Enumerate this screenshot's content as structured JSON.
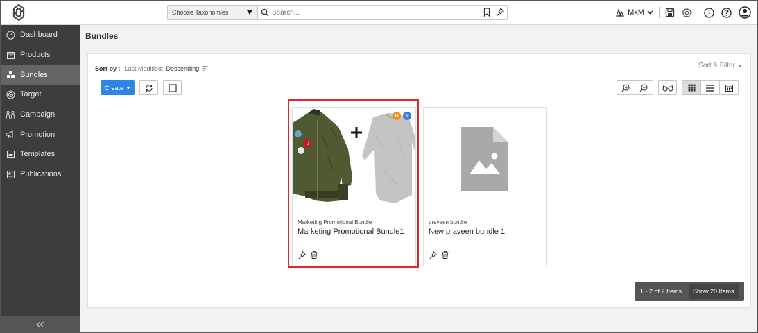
{
  "header": {
    "taxonomy_select": "Choose Taxonomies",
    "search_placeholder": "Search...",
    "user_label": "MxM"
  },
  "sidebar": {
    "items": [
      {
        "label": "Dashboard",
        "icon": "dashboard-icon"
      },
      {
        "label": "Products",
        "icon": "products-icon"
      },
      {
        "label": "Bundles",
        "icon": "bundles-icon",
        "active": true
      },
      {
        "label": "Target",
        "icon": "target-icon"
      },
      {
        "label": "Campaign",
        "icon": "campaign-icon"
      },
      {
        "label": "Promotion",
        "icon": "promotion-icon"
      },
      {
        "label": "Templates",
        "icon": "templates-icon"
      },
      {
        "label": "Publications",
        "icon": "publications-icon"
      }
    ]
  },
  "page": {
    "title": "Bundles"
  },
  "sort": {
    "label": "Sort by :",
    "field": "Last Modified:",
    "direction": "Descending",
    "filter_label": "Sort & Filter"
  },
  "toolbar": {
    "create_label": "Create"
  },
  "cards": [
    {
      "category": "Marketing Promotional Bundle",
      "name": "Marketing Promotional Bundle1",
      "badges": [
        "U",
        "N"
      ],
      "highlighted": true
    },
    {
      "category": "praveen bundle",
      "name": "New praveen bundle 1",
      "badges": []
    }
  ],
  "pager": {
    "count_text": "1 - 2 of 2 Items",
    "show_label": "Show 20 Items"
  },
  "colors": {
    "accent": "#2d86e5",
    "sidebar_bg": "#3d3d3d",
    "sidebar_active": "#646464",
    "highlight": "#e0262a",
    "badge_u": "#f08c1e",
    "badge_n": "#3a7fdc"
  }
}
